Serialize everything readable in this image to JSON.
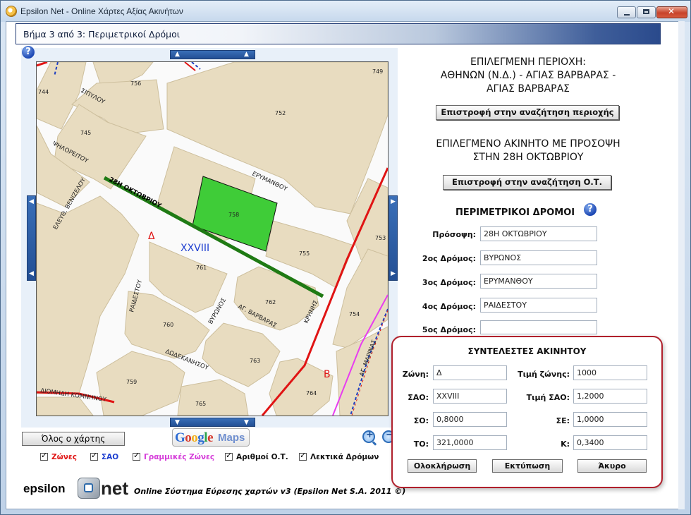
{
  "window": {
    "title": "Epsilon Net - Online Χάρτες Αξίας Ακινήτων"
  },
  "step": {
    "label": "Βήμα 3 από 3: Περιμετρικοί Δρόμοι"
  },
  "map": {
    "block_numbers": [
      "749",
      "744",
      "756",
      "752",
      "745",
      "758",
      "753",
      "755",
      "761",
      "762",
      "754",
      "760",
      "763",
      "759",
      "764",
      "765"
    ],
    "streets": {
      "sipylou": "ΣΙΠΥΛΟΥ",
      "filoreitou": "ΨΗΛΟΡΕΙΤΟΥ",
      "erymanthou": "ΕΡΥΜΑΝΘΟΥ",
      "okt28": "28Η ΟΚΤΩΒΡΙΟΥ",
      "venizelou": "ΕΛΕΥΘ. ΒΕΝΙΖΕΛΟΥ",
      "raidestou": "ΡΑΙΔΕΣΤΟΥ",
      "vyronos": "ΒΥΡΩΝΟΣ",
      "ag_varvaras": "ΑΓ. ΒΑΡΒΑΡΑΣ",
      "krinis": "ΚΡΗΝΗΣ",
      "ag_marinas": "ΑΓ. ΜΑΡΙΝΑΣ",
      "dodekanisou": "ΔΩΔΕΚΑΝΗΣΟΥ",
      "diomidi": "ΔΙΟΜΗΔΗ ΚΟΜΝΗΝΟΥ"
    },
    "zone_labels": {
      "zone_d": "Δ",
      "zone_v": "Β",
      "sao": "XXVIII"
    },
    "colors": {
      "block": "#e8dcc0",
      "road": "#fafafa",
      "selected_block": "#3fcc38",
      "frontage": "#1f7a14",
      "zone_line": "#e01414",
      "zone_line_alt": "#e83cf0",
      "sao_line": "#2040c0"
    }
  },
  "map_controls": {
    "whole_map": "Όλος ο χάρτης",
    "google_maps_g": "Google",
    "google_maps_m": "Maps",
    "zoom_in": "zoom-in",
    "zoom_out": "zoom-out"
  },
  "layers": [
    {
      "label": "Ζώνες",
      "color": "#e01414",
      "checked": true
    },
    {
      "label": "ΣΑΟ",
      "color": "#1e3fd0",
      "checked": true
    },
    {
      "label": "Γραμμικές Ζώνες",
      "color": "#d53cd9",
      "checked": true
    },
    {
      "label": "Αριθμοί Ο.Τ.",
      "color": "#111111",
      "checked": true
    },
    {
      "label": "Λεκτικά Δρόμων",
      "color": "#111111",
      "checked": true
    }
  ],
  "footer": {
    "logo_left": "epsilon",
    "logo_right": "net",
    "text": "Online Σύστημα Εύρεσης χαρτών v3 (Epsilon Net S.A. 2011 ©)"
  },
  "selected_area": {
    "line1": "ΕΠΙΛΕΓΜΕΝΗ ΠΕΡΙΟΧΗ:",
    "line2": "ΑΘΗΝΩΝ (Ν.Δ.) - ΑΓΙΑΣ ΒΑΡΒΑΡΑΣ -",
    "line3": "ΑΓΙΑΣ ΒΑΡΒΑΡΑΣ",
    "back_button": "Επιστροφή στην αναζήτηση περιοχής"
  },
  "selected_property": {
    "line1": "ΕΠΙΛΕΓΜΕΝΟ ΑΚΙΝΗΤΟ ΜΕ ΠΡΟΣΟΨΗ",
    "line2": "ΣΤΗΝ 28Η ΟΚΤΩΒΡΙΟΥ",
    "back_button": "Επιστροφή στην αναζήτηση Ο.Τ."
  },
  "perimeter": {
    "title": "ΠΕΡΙΜΕΤΡΙΚΟΙ ΔΡΟΜΟΙ",
    "fields": [
      {
        "label": "Πρόσοψη:",
        "value": "28Η ΟΚΤΩΒΡΙΟΥ"
      },
      {
        "label": "2ος Δρόμος:",
        "value": "ΒΥΡΩΝΟΣ"
      },
      {
        "label": "3ος Δρόμος:",
        "value": "ΕΡΥΜΑΝΘΟΥ"
      },
      {
        "label": "4ος Δρόμος:",
        "value": "ΡΑΙΔΕΣΤΟΥ"
      },
      {
        "label": "5ος Δρόμος:",
        "value": ""
      }
    ]
  },
  "coefficients": {
    "title": "ΣΥΝΤΕΛΕΣΤΕΣ ΑΚΙΝΗΤΟΥ",
    "zone": {
      "label": "Ζώνη:",
      "value": "Δ"
    },
    "zone_price": {
      "label": "Τιμή ζώνης:",
      "value": "1000"
    },
    "sao": {
      "label": "ΣΑΟ:",
      "value": "XXVIII"
    },
    "sao_price": {
      "label": "Τιμή ΣΑΟ:",
      "value": "1,2000"
    },
    "so": {
      "label": "ΣΟ:",
      "value": "0,8000"
    },
    "se": {
      "label": "ΣΕ:",
      "value": "1,0000"
    },
    "to": {
      "label": "ΤΟ:",
      "value": "321,0000"
    },
    "k": {
      "label": "Κ:",
      "value": "0,3400"
    },
    "buttons": {
      "complete": "Ολοκλήρωση",
      "print": "Εκτύπωση",
      "cancel": "Άκυρο"
    }
  }
}
